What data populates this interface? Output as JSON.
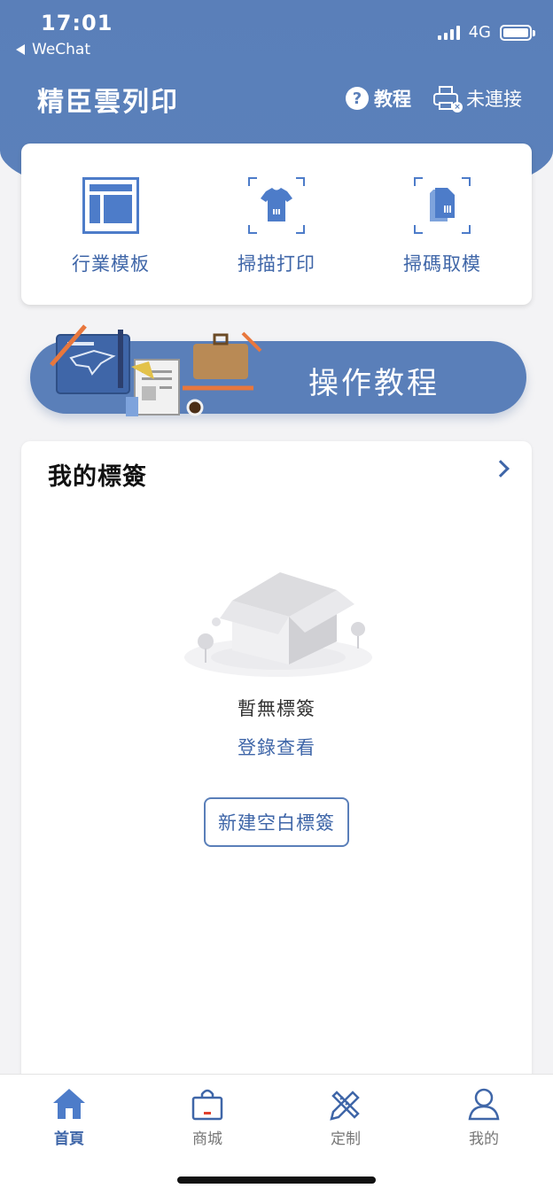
{
  "status_bar": {
    "time": "17:01",
    "back_app": "WeChat",
    "network": "4G"
  },
  "nav": {
    "title": "精臣雲列印",
    "help_label": "教程",
    "printer_status": "未連接"
  },
  "quick_actions": [
    {
      "label": "行業模板",
      "icon": "template-icon"
    },
    {
      "label": "掃描打印",
      "icon": "tshirt-scan-icon"
    },
    {
      "label": "掃碼取模",
      "icon": "document-scan-icon"
    }
  ],
  "banner": {
    "text": "操作教程"
  },
  "my_labels": {
    "title": "我的標簽",
    "empty_text": "暫無標簽",
    "login_link": "登錄查看",
    "new_button": "新建空白標簽"
  },
  "tabbar": [
    {
      "label": "首頁",
      "icon": "home-icon",
      "active": true
    },
    {
      "label": "商城",
      "icon": "shopping-bag-icon",
      "active": false
    },
    {
      "label": "定制",
      "icon": "pencil-ruler-icon",
      "active": false
    },
    {
      "label": "我的",
      "icon": "user-icon",
      "active": false
    }
  ],
  "colors": {
    "accent": "#5a7fb9",
    "accent_text": "#3f66a8",
    "background": "#f3f3f5"
  }
}
